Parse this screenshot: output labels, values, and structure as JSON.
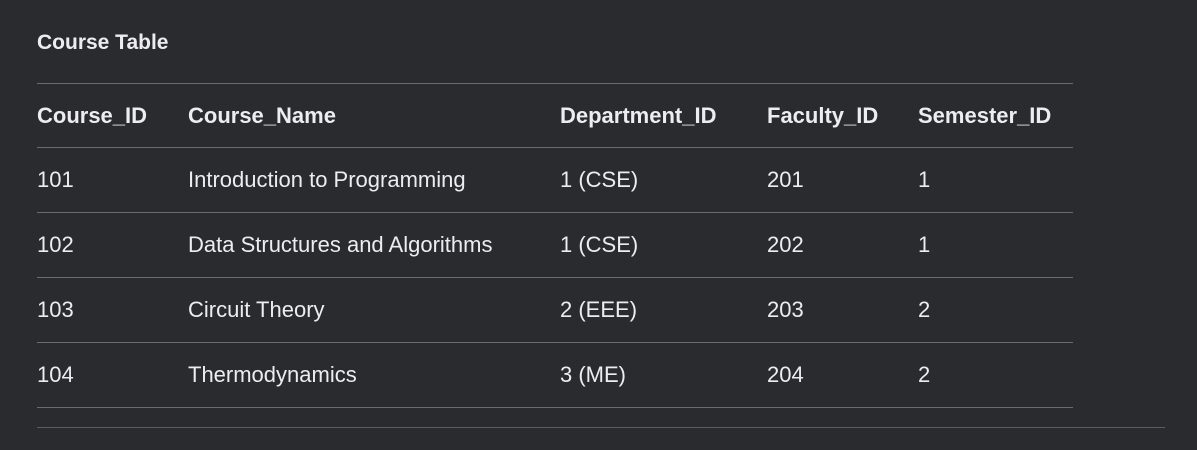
{
  "heading": "Course Table",
  "table": {
    "headers": [
      "Course_ID",
      "Course_Name",
      "Department_ID",
      "Faculty_ID",
      "Semester_ID"
    ],
    "rows": [
      [
        "101",
        "Introduction to Programming",
        "1 (CSE)",
        "201",
        "1"
      ],
      [
        "102",
        "Data Structures and Algorithms",
        "1 (CSE)",
        "202",
        "1"
      ],
      [
        "103",
        "Circuit Theory",
        "2 (EEE)",
        "203",
        "2"
      ],
      [
        "104",
        "Thermodynamics",
        "3 (ME)",
        "204",
        "2"
      ]
    ]
  },
  "colors": {
    "background": "#2a2b2f",
    "text": "#ececf1",
    "rule": "#6a6b70"
  }
}
